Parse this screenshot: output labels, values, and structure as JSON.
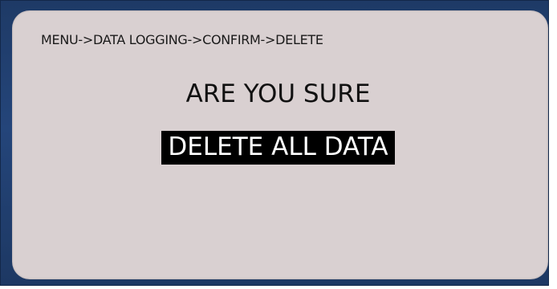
{
  "screen": {
    "breadcrumb": "MENU->DATA LOGGING->CONFIRM->DELETE",
    "prompt": "ARE YOU SURE",
    "action_label": "DELETE ALL DATA"
  },
  "colors": {
    "bezel": "#1e3a66",
    "screen_background": "#d9d0d1",
    "text": "#111111",
    "highlight_background": "#000000",
    "highlight_text": "#ffffff"
  }
}
